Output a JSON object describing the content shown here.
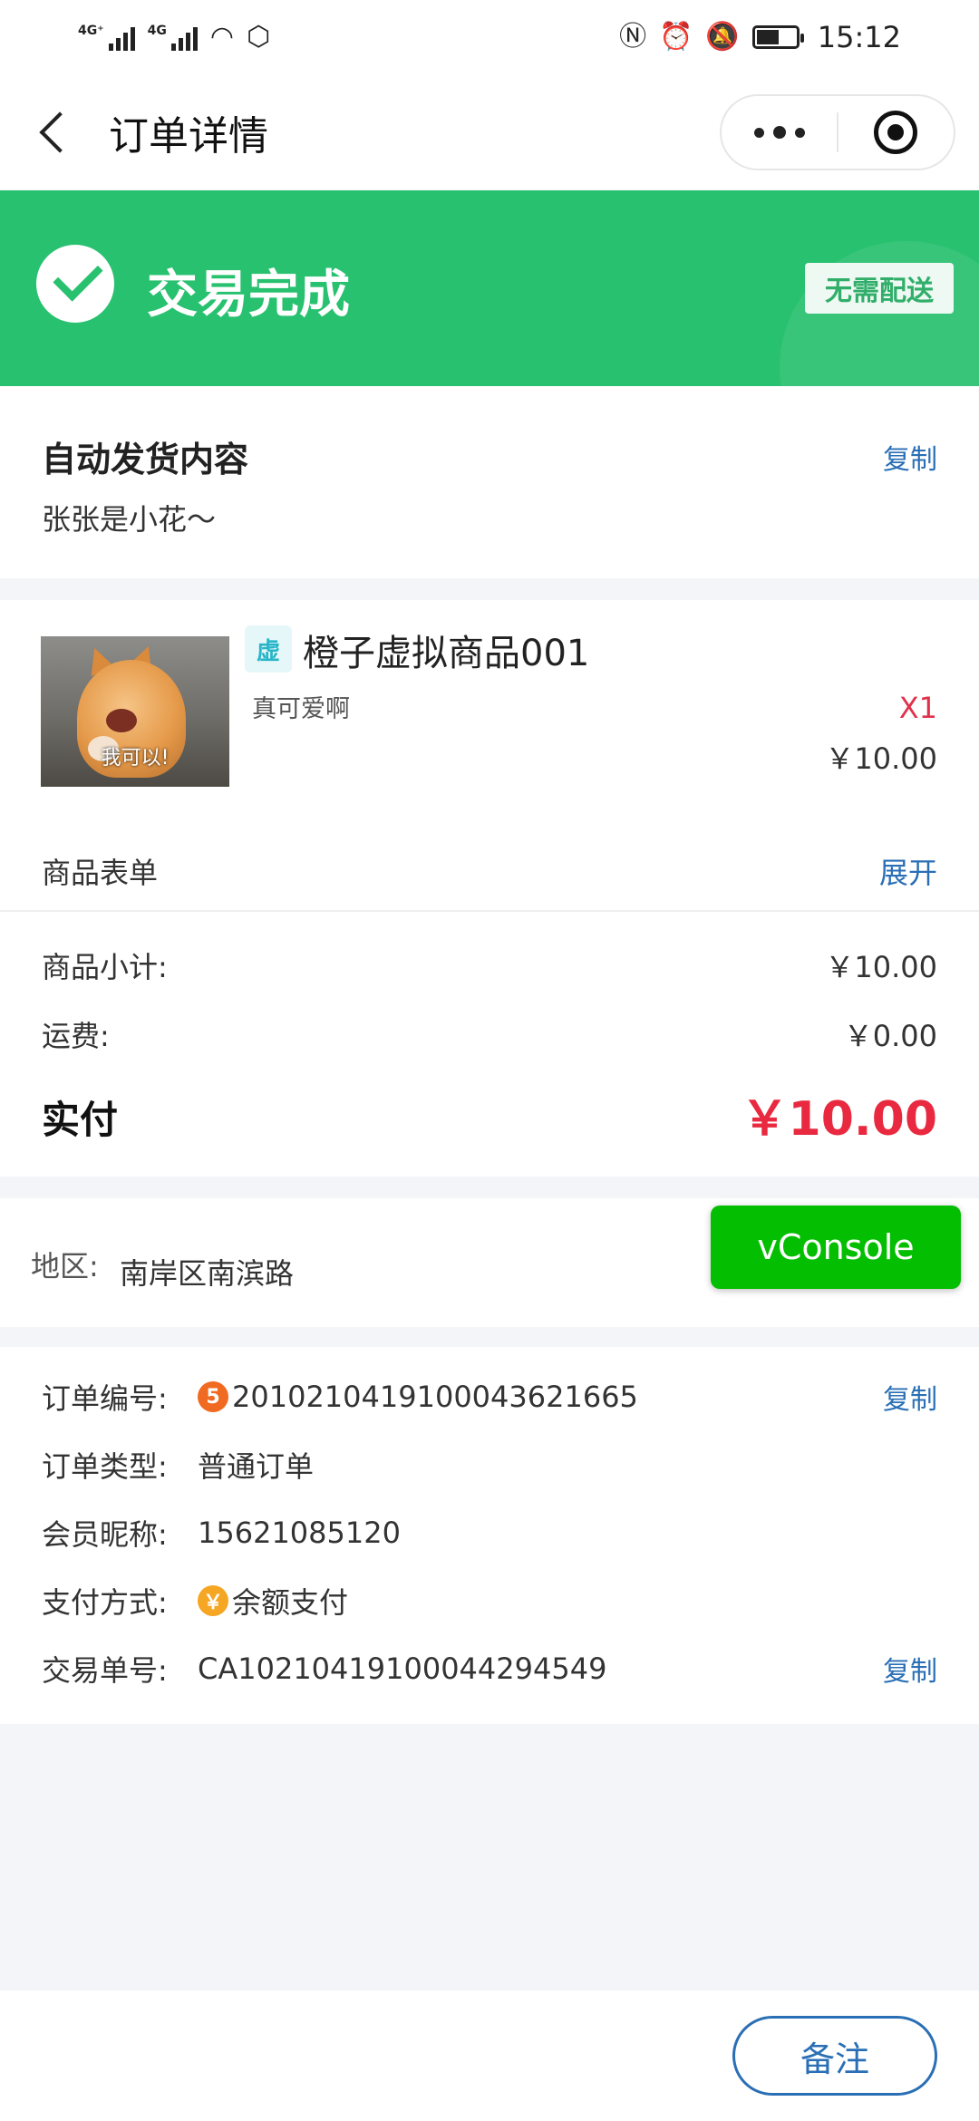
{
  "status_bar": {
    "network_1": "4G⁺",
    "network_2": "4G",
    "time": "15:12",
    "icons": [
      "signal-icon",
      "wifi-icon",
      "shield-icon",
      "nfc-icon",
      "alarm-icon",
      "mute-icon",
      "battery-icon"
    ]
  },
  "nav": {
    "title": "订单详情",
    "back_icon": "back-icon",
    "more_icon": "more-icon",
    "close_icon": "target-icon"
  },
  "banner": {
    "status": "交易完成",
    "badge": "无需配送",
    "color": "#28c16f"
  },
  "auto_delivery": {
    "title": "自动发货内容",
    "copy_label": "复制",
    "content": "张张是小花～"
  },
  "goods": {
    "thumb_caption": "我可以!",
    "virtual_tag": "虚",
    "name": "橙子虚拟商品001",
    "desc": "真可爱啊",
    "qty": "X1",
    "price": "￥10.00",
    "form_label": "商品表单",
    "form_toggle": "展开"
  },
  "summary": {
    "subtotal_label": "商品小计:",
    "subtotal_value": "￥10.00",
    "freight_label": "运费:",
    "freight_value": "￥0.00",
    "paid_label": "实付",
    "paid_value": "￥10.00",
    "paid_color": "#e8293f"
  },
  "region": {
    "label": "地区:",
    "value": "南岸区南滨路"
  },
  "vconsole": {
    "label": "vConsole",
    "color": "#04be02"
  },
  "order_info": {
    "order_no_label": "订单编号:",
    "order_no_icon": "5",
    "order_no": "2010210419100043621665",
    "order_no_copy": "复制",
    "type_label": "订单类型:",
    "type_value": "普通订单",
    "member_label": "会员昵称:",
    "member_value": "15621085120",
    "pay_method_label": "支付方式:",
    "pay_method_icon": "￥",
    "pay_method_value": "余额支付",
    "trade_no_label": "交易单号:",
    "trade_no": "CA102104191000442945​49",
    "trade_no_copy": "复制"
  },
  "bottom": {
    "remark_label": "备注"
  }
}
